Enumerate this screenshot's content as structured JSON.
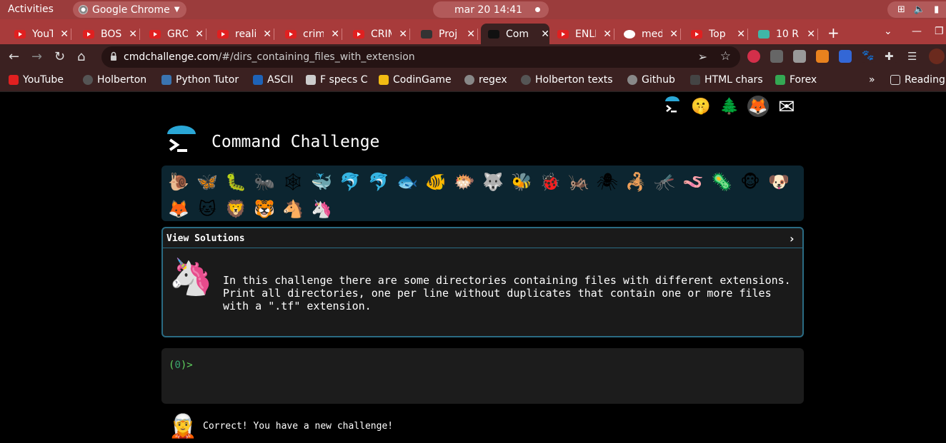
{
  "topbar": {
    "activities": "Activities",
    "app_name": "Google Chrome",
    "clock": "mar 20  14:41"
  },
  "tabs": [
    {
      "title": "YouTube",
      "favicon": "youtube"
    },
    {
      "title": "BOS",
      "favicon": "youtube"
    },
    {
      "title": "GRO",
      "favicon": "youtube"
    },
    {
      "title": "reali",
      "favicon": "youtube"
    },
    {
      "title": "crim",
      "favicon": "youtube"
    },
    {
      "title": "CRIM",
      "favicon": "youtube"
    },
    {
      "title": "Proj",
      "favicon": "holberton"
    },
    {
      "title": "Com",
      "favicon": "cmdchallenge",
      "active": true
    },
    {
      "title": "ENLI",
      "favicon": "youtube"
    },
    {
      "title": "med",
      "favicon": "google"
    },
    {
      "title": "Top",
      "favicon": "youtube"
    },
    {
      "title": "10 R",
      "favicon": "other"
    }
  ],
  "toolbar": {
    "url_host": "cmdchallenge.com",
    "url_path": "/#/dirs_containing_files_with_extension"
  },
  "bookmarks": [
    {
      "label": "YouTube",
      "icon": "youtube",
      "color": "#e02020"
    },
    {
      "label": "Holberton",
      "icon": "holberton",
      "color": "#555555"
    },
    {
      "label": "Python Tutor",
      "icon": "python",
      "color": "#3a74b0"
    },
    {
      "label": "ASCII",
      "icon": "ascii",
      "color": "#1e63b8"
    },
    {
      "label": "F specs C",
      "icon": "doc",
      "color": "#cccccc"
    },
    {
      "label": "CodinGame",
      "icon": "codingame",
      "color": "#f2bb13"
    },
    {
      "label": "regex",
      "icon": "github",
      "color": "#888888"
    },
    {
      "label": "Holberton texts",
      "icon": "holberton",
      "color": "#555555"
    },
    {
      "label": "Github",
      "icon": "github",
      "color": "#888888"
    },
    {
      "label": "HTML chars",
      "icon": "html",
      "color": "#444444"
    },
    {
      "label": "Forex",
      "icon": "forex",
      "color": "#34a853"
    }
  ],
  "bookmarks_overflow": "»",
  "reading_list": "Reading",
  "page": {
    "site_title": "Command Challenge",
    "emojis": [
      "🐌",
      "🦋",
      "🐛",
      "🐜",
      "🕸",
      "🐳",
      "🐬",
      "🐬",
      "🐟",
      "🐠",
      "🐡",
      "🐺",
      "🐝",
      "🐞",
      "🦗",
      "🕷",
      "🦂",
      "🦟",
      "🪱",
      "🦠",
      "🐵",
      "🐶",
      "🦊",
      "🐱",
      "🦁",
      "🐯",
      "🐴",
      "🦄"
    ],
    "social_icons": [
      "🤫",
      "🌲",
      "🦊",
      "✉"
    ],
    "view_solutions": "View Solutions",
    "chevron": "›",
    "challenge_emoji": "🦄",
    "description": "In this challenge there are some directories containing files with different extensions. Print all directories, one per line without duplicates that contain one or more files with a \".tf\" extension.",
    "prompt_open": "(",
    "prompt_num": "0",
    "prompt_close": ")>",
    "feedback_emoji": "🧝",
    "feedback": "Correct! You have a new challenge!"
  }
}
